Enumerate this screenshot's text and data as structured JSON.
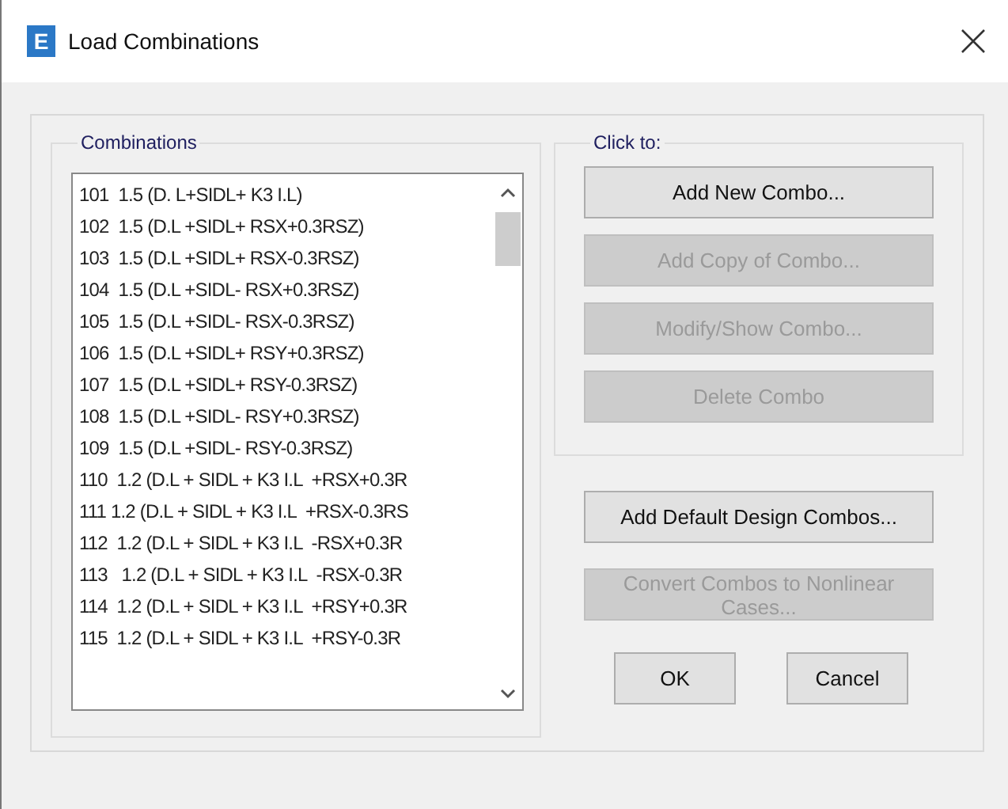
{
  "window": {
    "logo": "E",
    "title": "Load Combinations"
  },
  "combinations": {
    "label": "Combinations",
    "items": [
      {
        "text": "101  1.5 (D. L+SIDL+ K3 I.L)",
        "selected": false
      },
      {
        "text": "102  1.5 (D.L +SIDL+ RSX+0.3RSZ)",
        "selected": false
      },
      {
        "text": "103  1.5 (D.L +SIDL+ RSX-0.3RSZ)",
        "selected": false
      },
      {
        "text": "104  1.5 (D.L +SIDL- RSX+0.3RSZ)",
        "selected": false
      },
      {
        "text": "105  1.5 (D.L +SIDL- RSX-0.3RSZ)",
        "selected": false
      },
      {
        "text": "106  1.5 (D.L +SIDL+ RSY+0.3RSZ)",
        "selected": false
      },
      {
        "text": "107  1.5 (D.L +SIDL+ RSY-0.3RSZ)",
        "selected": false
      },
      {
        "text": "108  1.5 (D.L +SIDL- RSY+0.3RSZ)",
        "selected": false
      },
      {
        "text": "109  1.5 (D.L +SIDL- RSY-0.3RSZ)",
        "selected": false
      },
      {
        "text": "110  1.2 (D.L + SIDL + K3 I.L  +RSX+0.3R",
        "selected": false
      },
      {
        "text": "111 1.2 (D.L + SIDL + K3 I.L  +RSX-0.3RS",
        "selected": false
      },
      {
        "text": "112  1.2 (D.L + SIDL + K3 I.L  -RSX+0.3R",
        "selected": false
      },
      {
        "text": "113   1.2 (D.L + SIDL + K3 I.L  -RSX-0.3R",
        "selected": false
      },
      {
        "text": "114  1.2 (D.L + SIDL + K3 I.L  +RSY+0.3R",
        "selected": false
      },
      {
        "text": "115  1.2 (D.L + SIDL + K3 I.L  +RSY-0.3R",
        "selected": false
      }
    ]
  },
  "click_to": {
    "label": "Click to:",
    "buttons": [
      {
        "label": "Add New Combo...",
        "disabled": false
      },
      {
        "label": "Add Copy of Combo...",
        "disabled": true
      },
      {
        "label": "Modify/Show Combo...",
        "disabled": true
      },
      {
        "label": "Delete Combo",
        "disabled": true
      }
    ]
  },
  "extra_buttons": [
    {
      "label": "Add Default Design Combos...",
      "disabled": false
    },
    {
      "label": "Convert Combos to Nonlinear Cases...",
      "disabled": true
    }
  ],
  "dialog_buttons": [
    {
      "label": "OK"
    },
    {
      "label": "Cancel"
    }
  ]
}
